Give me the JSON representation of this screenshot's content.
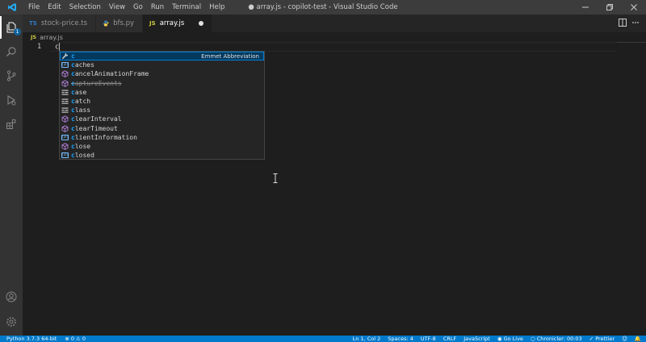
{
  "titlebar": {
    "menu": [
      "File",
      "Edit",
      "Selection",
      "View",
      "Go",
      "Run",
      "Terminal",
      "Help"
    ],
    "window_title": "● array.js - copilot-test - Visual Studio Code"
  },
  "activity": {
    "explorer_badge": "1"
  },
  "tabs": [
    {
      "icon": "TS",
      "label": "stock-price.ts"
    },
    {
      "icon": "py",
      "label": "bfs.py"
    },
    {
      "icon": "JS",
      "label": "array.js"
    }
  ],
  "breadcrumb": {
    "icon": "JS",
    "file": "array.js"
  },
  "editor": {
    "line_number": "1",
    "typed": "c"
  },
  "suggest": {
    "items": [
      {
        "icon": "wrench-icon",
        "match": "c",
        "rest": "",
        "detail": "Emmet Abbreviation"
      },
      {
        "icon": "variable-icon",
        "match": "c",
        "rest": "aches"
      },
      {
        "icon": "method-icon",
        "match": "c",
        "rest": "ancelAnimationFrame"
      },
      {
        "icon": "method-icon",
        "match": "c",
        "rest": "aptureEvents",
        "deprecated": true
      },
      {
        "icon": "keyword-icon",
        "match": "c",
        "rest": "ase"
      },
      {
        "icon": "keyword-icon",
        "match": "c",
        "rest": "atch"
      },
      {
        "icon": "keyword-icon",
        "match": "c",
        "rest": "lass"
      },
      {
        "icon": "method-icon",
        "match": "c",
        "rest": "learInterval"
      },
      {
        "icon": "method-icon",
        "match": "c",
        "rest": "learTimeout"
      },
      {
        "icon": "variable-icon",
        "match": "c",
        "rest": "lientInformation"
      },
      {
        "icon": "method-icon",
        "match": "c",
        "rest": "lose"
      },
      {
        "icon": "variable-icon",
        "match": "c",
        "rest": "losed"
      }
    ]
  },
  "status": {
    "python": "Python 3.7.3 64-bit",
    "problems": "⊗ 0  ⚠ 0",
    "position": "Ln 1, Col 2",
    "spaces": "Spaces: 4",
    "encoding": "UTF-8",
    "eol": "CRLF",
    "language": "JavaScript",
    "golive": "Go Live",
    "chronicler": "Chronicler: 00:03",
    "prettier": "✓ Prettier"
  },
  "colors": {
    "accent": "#007acc",
    "match": "#18a3ff",
    "selection": "#04395e"
  }
}
